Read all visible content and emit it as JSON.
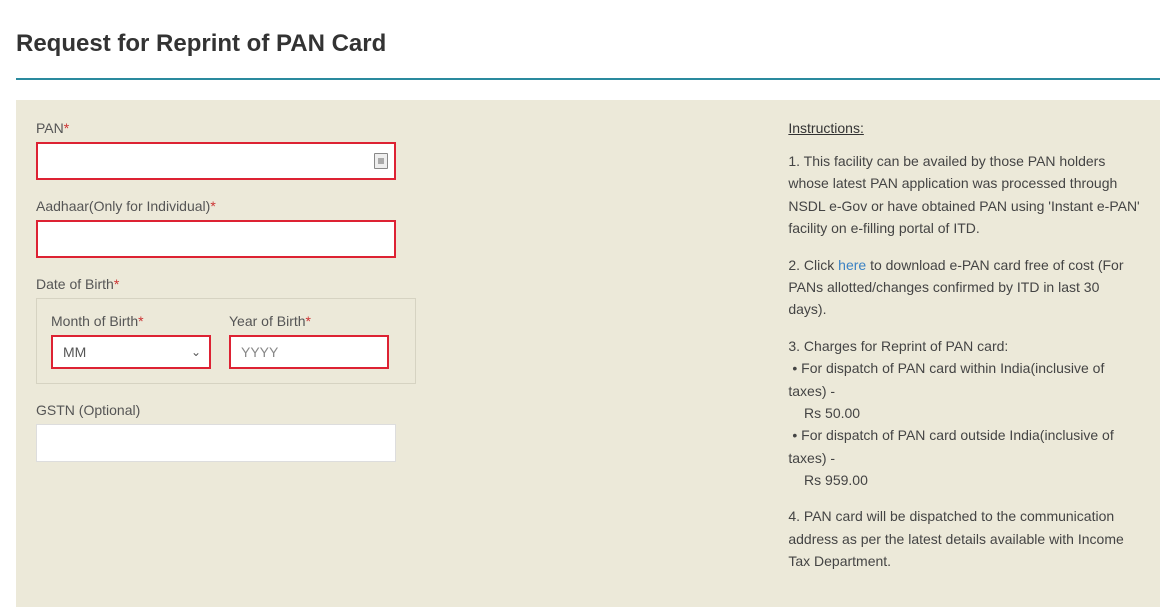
{
  "page_title": "Request for Reprint of PAN Card",
  "form": {
    "pan_label": "PAN",
    "aadhaar_label": "Aadhaar(Only for Individual)",
    "dob_label": "Date of Birth",
    "month_label": "Month of Birth",
    "year_label": "Year of Birth",
    "month_selected": "MM",
    "year_placeholder": "YYYY",
    "gstn_label": "GSTN (Optional)",
    "required_mark": "*"
  },
  "instructions": {
    "header": "Instructions",
    "header_colon": ":",
    "p1": "1. This facility can be availed by those PAN holders whose latest PAN application was processed through NSDL e-Gov or have obtained PAN using 'Instant e-PAN' facility on e-filling portal of ITD.",
    "p2a": "2. Click ",
    "p2_link": "here",
    "p2b": " to download e-PAN card free of cost (For PANs allotted/changes confirmed by ITD in last 30 days).",
    "p3": "3. Charges for Reprint of PAN card:",
    "p3a": "• For dispatch of PAN card within India(inclusive of taxes) -",
    "p3a_amt": "   Rs 50.00",
    "p3b": "• For dispatch of PAN card outside India(inclusive of taxes) -",
    "p3b_amt": "   Rs 959.00",
    "p4": "4. PAN card will be dispatched to the communication address as per the latest details available with Income Tax Department."
  }
}
